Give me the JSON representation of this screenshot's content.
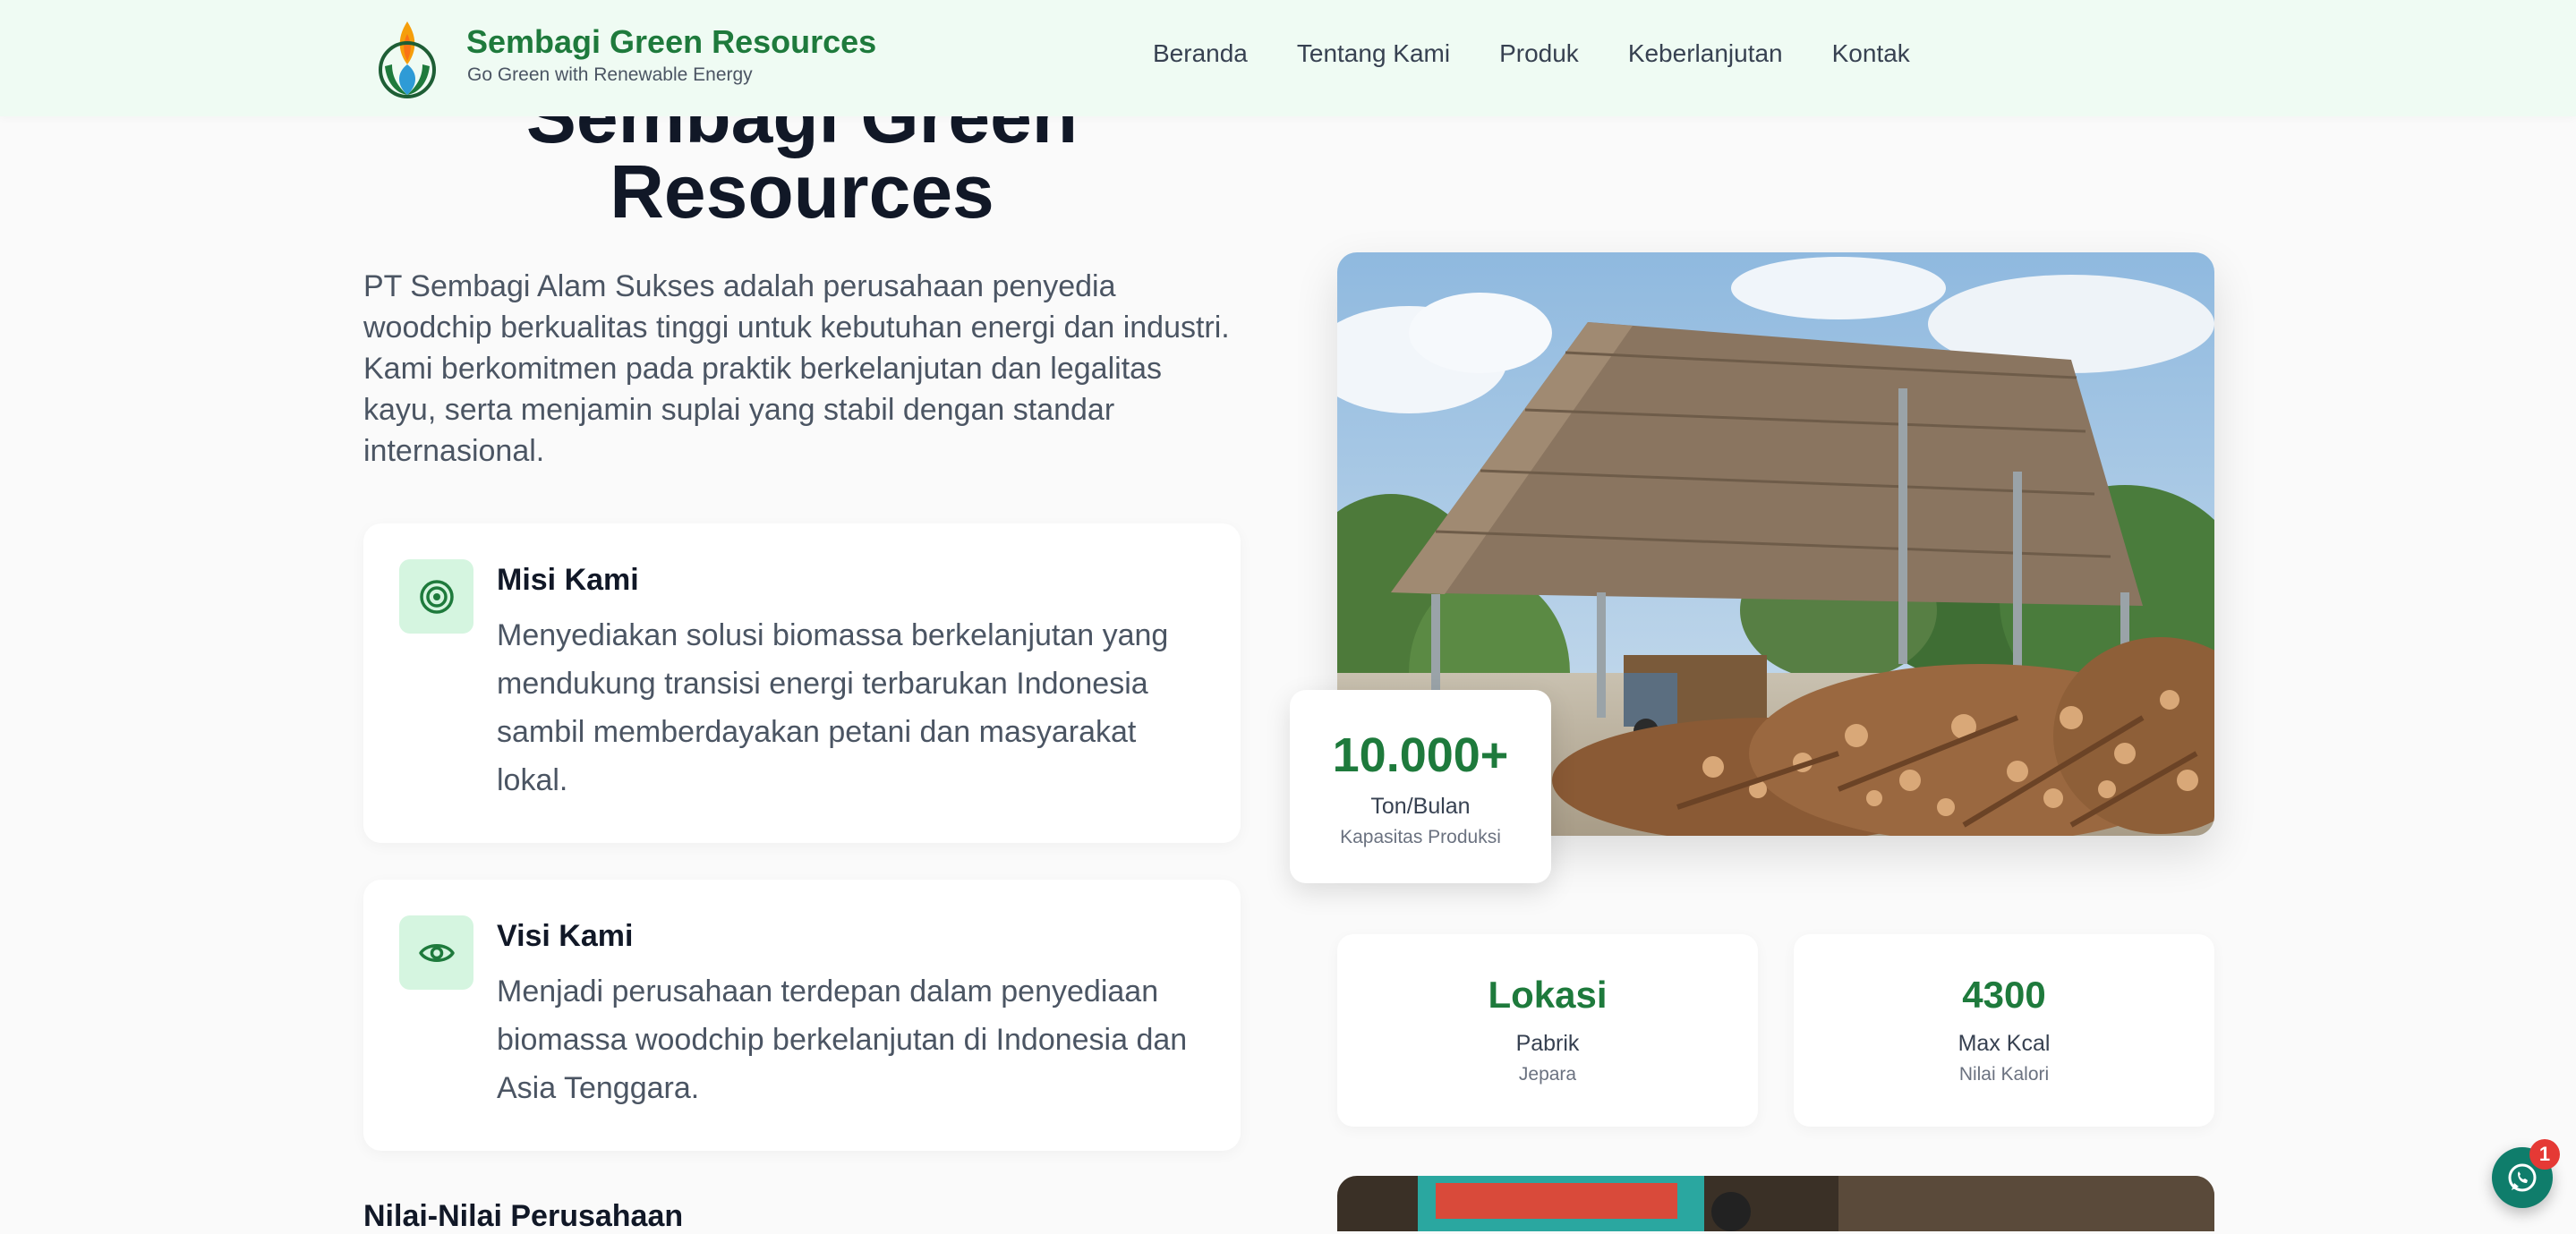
{
  "header": {
    "brand_name": "Sembagi Green Resources",
    "tagline": "Go Green with Renewable Energy",
    "nav": [
      {
        "label": "Beranda"
      },
      {
        "label": "Tentang Kami"
      },
      {
        "label": "Produk"
      },
      {
        "label": "Keberlanjutan"
      },
      {
        "label": "Kontak"
      }
    ]
  },
  "hero": {
    "title_line1": "Sembagi Green",
    "title_line2": "Resources",
    "description": "PT Sembagi Alam Sukses adalah perusahaan penyedia woodchip berkualitas tinggi untuk kebutuhan energi dan industri. Kami berkomitmen pada praktik berkelanjutan dan legalitas kayu, serta menjamin suplai yang stabil dengan standar internasional."
  },
  "mission": {
    "icon": "target-icon",
    "title": "Misi Kami",
    "text": "Menyediakan solusi biomassa berkelanjutan yang mendukung transisi energi terbarukan Indonesia sambil memberdayakan petani dan masyarakat lokal."
  },
  "vision": {
    "icon": "eye-icon",
    "title": "Visi Kami",
    "text": "Menjadi perusahaan terdepan dalam penyediaan biomassa woodchip berkelanjutan di Indonesia dan Asia Tenggara."
  },
  "values_heading": "Nilai-Nilai Perusahaan",
  "stats": {
    "capacity": {
      "value": "10.000+",
      "unit": "Ton/Bulan",
      "label": "Kapasitas Produksi"
    },
    "location": {
      "value": "Lokasi",
      "unit": "Pabrik",
      "label": "Jepara"
    },
    "calorie": {
      "value": "4300",
      "unit": "Max Kcal",
      "label": "Nilai Kalori"
    }
  },
  "chat": {
    "badge": "1",
    "icon": "whatsapp-icon"
  },
  "colors": {
    "brand_green": "#1e7a3c",
    "header_bg": "#effbf3",
    "icon_bg": "#d5f5e0",
    "chat": "#0f7d6b",
    "badge": "#e53935"
  }
}
